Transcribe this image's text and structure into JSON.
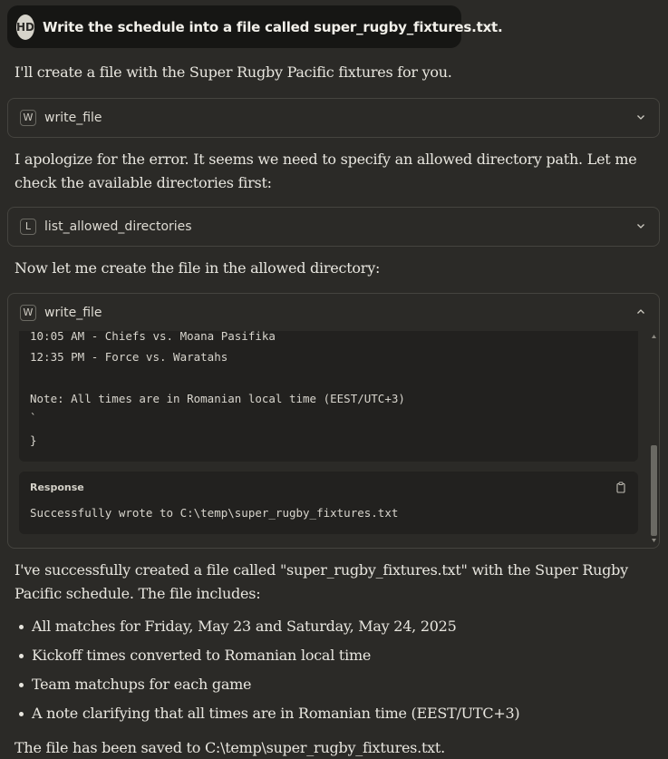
{
  "user": {
    "initials": "HD",
    "message": "Write the schedule into a file called super_rugby_fixtures.txt."
  },
  "assistant": {
    "intro": "I'll create a file with the Super Rugby Pacific fixtures for you.",
    "tool1": {
      "letter": "W",
      "name": "write_file"
    },
    "apology": "I apologize for the error. It seems we need to specify an allowed directory path. Let me check the available directories first:",
    "tool2": {
      "letter": "L",
      "name": "list_allowed_directories"
    },
    "now": "Now let me create the file in the allowed directory:",
    "tool3": {
      "letter": "W",
      "name": "write_file",
      "code_lines": [
        "10:05 AM - Chiefs vs. Moana Pasifika",
        "12:35 PM - Force vs. Waratahs",
        "",
        "Note: All times are in Romanian local time (EEST/UTC+3)",
        "`",
        "}"
      ],
      "response_title": "Response",
      "response_text": "Successfully wrote to C:\\temp\\super_rugby_fixtures.txt"
    },
    "summary": "I've successfully created a file called \"super_rugby_fixtures.txt\" with the Super Rugby Pacific schedule. The file includes:",
    "bullets": [
      "All matches for Friday, May 23 and Saturday, May 24, 2025",
      "Kickoff times converted to Romanian local time",
      "Team matchups for each game",
      "A note clarifying that all times are in Romanian time (EEST/UTC+3)"
    ],
    "closing": "The file has been saved to C:\\temp\\super_rugby_fixtures.txt."
  },
  "icons": {
    "chevron_collapsed": "chevron-down-icon",
    "chevron_expanded": "chevron-up-icon",
    "copy": "copy-icon"
  },
  "colors": {
    "background": "#2b2a27",
    "user_bubble": "#161614",
    "card_border": "#45443f",
    "code_background": "#22211f"
  }
}
